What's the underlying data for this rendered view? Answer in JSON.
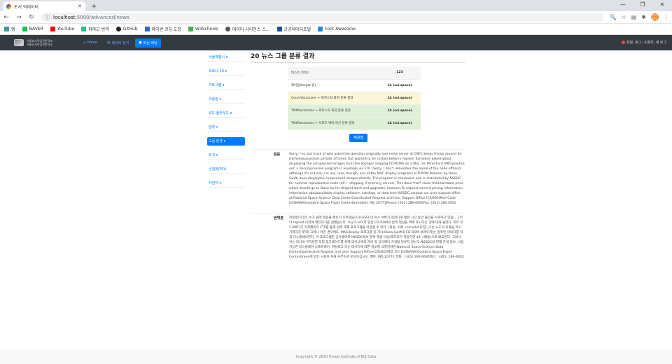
{
  "browser": {
    "tab_title": "토서 빅데이터",
    "url_host": "localhost",
    "url_path": ":5000/advanced/news",
    "profile": "일시중지"
  },
  "bookmarks": [
    "앱",
    "NAVER",
    "YouTube",
    "파파고 번역",
    "GitHub",
    "파이썬 코딩 도장",
    "W3Schools",
    "데이터 사이언스 스...",
    "공공데이터포털",
    "Font Awesome"
  ],
  "nav": {
    "logo_line1": "서울호서직업전문학교",
    "logo_line2": "서울호서직업전문학교",
    "home": "Home",
    "data": "데이터 분석",
    "ml": "머신 러닝",
    "user": "회원, 로그: 소양각, 새 로그"
  },
  "sidebar": [
    "서울특별시",
    "코로나-19",
    "카토그램",
    "크롤링",
    "워드 클라우드",
    "분류",
    "고급 분류",
    "회귀",
    "군집화/PCA",
    "자연어"
  ],
  "page": {
    "title": "20 뉴스 그룹 분류 결과"
  },
  "results": [
    {
      "label": "테스트 인덱스",
      "value": "123"
    },
    {
      "label": "레이블(target 값)",
      "value": "14 (sci.space)"
    },
    {
      "label": "CountVectorizer + 로지스틱 회귀 분류 결과",
      "value": "14 (sci.space)"
    },
    {
      "label": "TfidfVectorizer + 로지스틱 회귀 분류 결과",
      "value": "14 (sci.space)"
    },
    {
      "label": "TfidfVectorizer + 서포트 벡터 머신 분류 결과",
      "value": "14 (sci.space)"
    }
  ],
  "rerun_label": "재실행",
  "original": {
    "label": "원문",
    "text": "Sorry, I've lost track of who asked the question originally (our news server at GSFC keeps things around for tremendouslyshort periods of time), but wanted to be certain before I replied. Someone asked about displaying the compressed images from the Voyager imaging CD-ROMs on a Mac. As Peter Ford (MIT)pointed out, a decompression program is available via FTP. (Sorry, I don't remember the name of the node offhand, although it's mit.edu.) In any case, though, one of the MAC display programs (CD ROM Browser by Dana Swift) does displaythe compressed images directly. The program is shareware and is distributed by NSSDC for nominal reproduction costs ($9 + shipping, if memory serves). This does *not* cover theshareware price which should go to Dana for his diligent work and upgrades, however.To request current pricing information, information aboutavailable display software, catalogs, or data from NSSDC,contact our user support office at:National Space Science Data CenterCoordinated Request and User Support Office (CRUSO)Mail Code 633NASA/Goddard Space Flight CenterGreenbelt, MD 20771Phone: (301) 286-6695Fax: (301) 286-4952"
  },
  "translation": {
    "label": "번역본",
    "text": "죄송합니다만, 누가 원래 질문을 했는지 모르겠습니다(GSFC의 뉴스 서버가 엄청나게 짧은 시간 동안 물건을 보관하고 있음). 그러나 replied 이전에 확인하기를 원했습니다. 누군가 보이저 영상 CD-ROM의 압축 영상을 맥에 표시하는 것에 대해 물었다. 피터 포드(MIT)가 지적했듯이 FTP를 통해 압축 해제 프로그램을 이용할 수 있다. (죄송, 비록 .mit.edu이지만, 나는 노드의 이름을 즉시 기억하지 못해) 그러나 어떤 경우에도, MACdisplay 프로그램 중 하나(Dana Swift의 CD ROM 브라우저)는 압축된 이미지를 직접 디스플레이한다. 이 프로그램은 공유웨어로 NSSDC에서 명목 재생 비용(메모리가 작동하면 $9 +배송)으로 배포된다. 그러나 이는 다나의 부지런한 작업 업그레이드를 위해 데이나에게 가야 할 공유웨어 가격을 다루지 않는다.NSSDC의 현재 가격 정보, 사용 가능한 디스플레이 소프트웨어, 카탈로그 또는 데이터에 대한 정보를 요청하려면,National Space Science Data CenterCoordinated Request and User Support Office(CRUSO)메일 코드 633NASA/Goddard Space Flight CenterGreen에 있는 사용자 지원 사무소에 문의하십시오. 벨트, MD 20771 전화 : (301) 286-6695팩스 : (301) 286-4952"
  },
  "footer": "Copyright © 2020 Hoseo Institute of Big Data"
}
